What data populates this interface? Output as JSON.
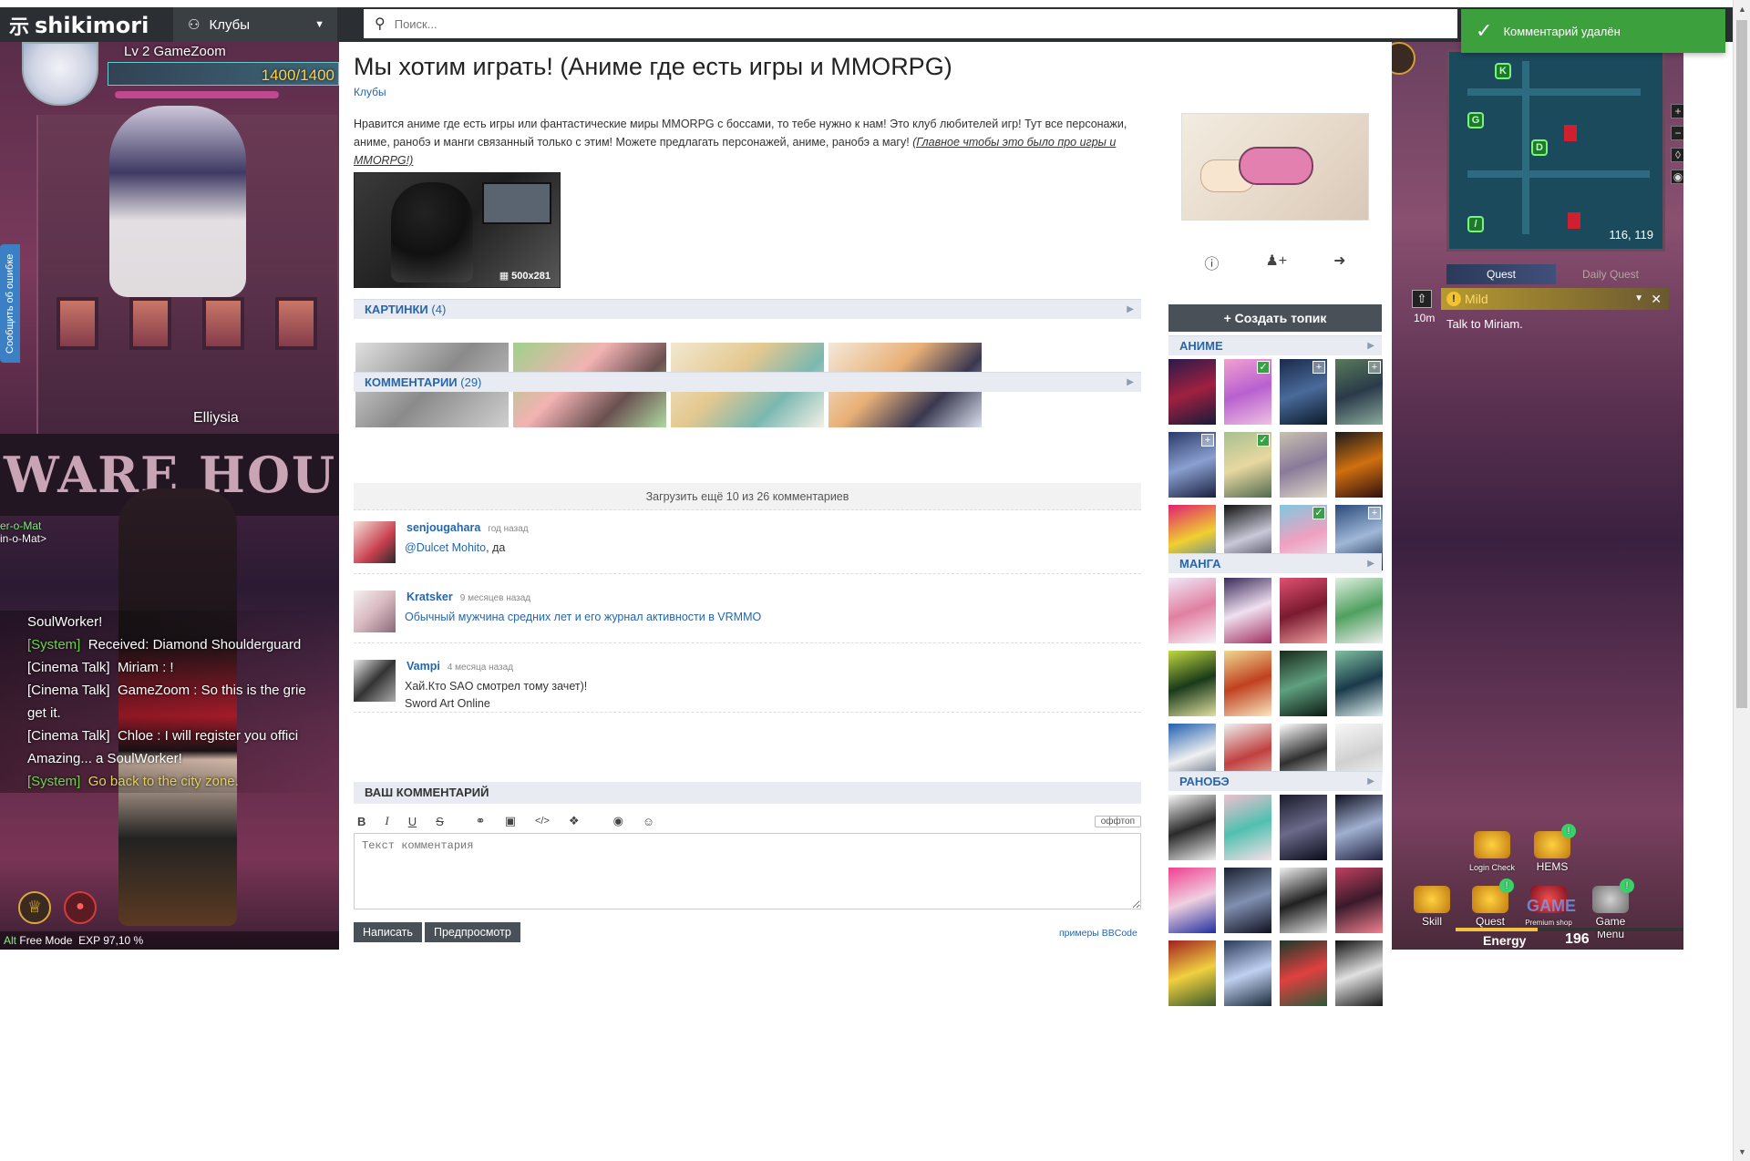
{
  "header": {
    "logo_text": "shikimori",
    "logo_icon": "shiki-glyph",
    "nav_label": "Клубы",
    "nav_icon": "users-icon",
    "search_placeholder": "Поиск...",
    "search_icon": "search-icon"
  },
  "toast": {
    "text": "Комментарий удалён",
    "icon": "check-icon",
    "color": "#3ca03c"
  },
  "report_tab": "Сообщить об ошибке",
  "left_game": {
    "level": "Lv 2 GameZoom",
    "hp": "1400/1400",
    "character_name": "Elliysia",
    "npc_label": "er-o-Mat",
    "npc_sub": "in-o-Mat>",
    "sign_text": "WARE HOUSE",
    "chat": [
      {
        "who": "",
        "text": "SoulWorker!",
        "type": "plain"
      },
      {
        "who": "[System]",
        "text": "Received: Diamond Shoulderguard",
        "type": "sys"
      },
      {
        "who": "[Cinema Talk]",
        "text": "Miriam : !",
        "type": "plain"
      },
      {
        "who": "[Cinema Talk]",
        "text": "GameZoom : So this is the grie",
        "type": "plain"
      },
      {
        "who": "",
        "text": "get it.",
        "type": "plain"
      },
      {
        "who": "[Cinema Talk]",
        "text": "Chloe : I will register you offici",
        "type": "plain"
      },
      {
        "who": "",
        "text": "Amazing... a SoulWorker!",
        "type": "plain"
      },
      {
        "who": "[System]",
        "text": "Go back to the city zone.",
        "type": "sysg"
      }
    ],
    "mode_key": "Alt",
    "mode": "Free Mode",
    "exp": "EXP 97,10 %"
  },
  "right_game": {
    "coords": "116, 119",
    "quest_tab_active": "Quest",
    "quest_tab_inactive": "Daily Quest",
    "quest_time": "10m",
    "quest_name": "Mild",
    "quest_desc": "Talk to Miriam.",
    "menu": [
      {
        "label": "Login Check",
        "badge": ""
      },
      {
        "label": "HEMS",
        "badge": "!"
      },
      {
        "label": "Skill",
        "badge": ""
      },
      {
        "label": "Quest",
        "badge": "!"
      },
      {
        "label": "Premium shop",
        "badge": ""
      },
      {
        "label": "Game Menu",
        "badge": "!"
      }
    ],
    "energy_label": "Energy",
    "energy_value": "196",
    "energy_level": 0.36,
    "watermark": "GAME"
  },
  "page": {
    "title": "Мы хотим играть! (Аниме где есть игры и MMORPG)",
    "breadcrumb": "Клубы",
    "description": "Нравится аниме где есть игры или фантастические миры MMORPG с боссами, то тебе нужно к нам! Это клуб любителей игр! Тут все персонажи, аниме, ранобэ и манги связанный только с этим! Можете предлагать персонажей, аниме, ранобэ а магу!",
    "description_note": "(Главное чтобы это было про игры и MMORPG!)",
    "image_size": "500x281"
  },
  "pictures": {
    "label": "КАРТИНКИ",
    "count": "(4)"
  },
  "comments": {
    "label": "КОММЕНТАРИИ",
    "count": "(29)",
    "load_more": "Загрузить ещё 10 из 26 комментариев",
    "items": [
      {
        "nick": "senjougahara",
        "when": "год назад",
        "mention": "@Dulcet Mohito",
        "text": ", да",
        "text2": ""
      },
      {
        "nick": "Kratsker",
        "when": "9 месяцев назад",
        "mention": "Обычный мужчина средних лет и его журнал активности в VRMMO",
        "text": "",
        "text2": ""
      },
      {
        "nick": "Vampi",
        "when": "4 месяца назад",
        "mention": "",
        "text": "Хай.Кто SAO смотрел тому зачет)!",
        "text2": "Sword Art Online"
      }
    ]
  },
  "editor": {
    "label": "ВАШ КОММЕНТАРИЙ",
    "placeholder": "Текст комментария",
    "offtopic": "оффтоп",
    "submit": "Написать",
    "preview": "Предпросмотр",
    "bbcode_link": "примеры BBCode",
    "tools": [
      "B",
      "I",
      "U",
      "S",
      "link",
      "image",
      "code",
      "spoiler",
      "upload",
      "smiley"
    ]
  },
  "sidebar": {
    "create_topic": "Создать топик",
    "actions": [
      "info-icon",
      "join-icon",
      "leave-icon"
    ],
    "anime_label": "АНИМЕ",
    "manga_label": "МАНГА",
    "ranobe_label": "РАНОБЭ"
  },
  "colors": {
    "accent": "#2566ac",
    "header_bg": "#2b2f33",
    "section_bg": "#e8ecf2",
    "button_bg": "#4a5058"
  }
}
